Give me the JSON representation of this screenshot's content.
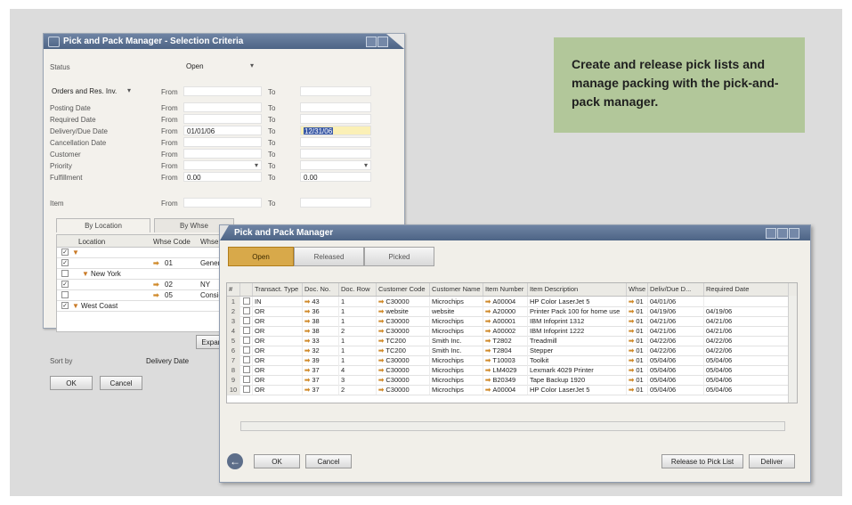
{
  "callout": {
    "text": "Create and release pick lists and manage packing with the pick-and-pack manager."
  },
  "selection_window": {
    "title": "Pick and Pack Manager - Selection Criteria",
    "status_label": "Status",
    "status_value": "Open",
    "doc_type": "Orders and Res. Inv.",
    "from_label": "From",
    "to_label": "To",
    "rows": [
      {
        "label": "Posting Date",
        "from": "",
        "to": ""
      },
      {
        "label": "Required Date",
        "from": "",
        "to": ""
      },
      {
        "label": "Delivery/Due Date",
        "from": "01/01/06",
        "to": "12/31/06"
      },
      {
        "label": "Cancellation Date",
        "from": "",
        "to": ""
      },
      {
        "label": "Customer",
        "from": "",
        "to": ""
      },
      {
        "label": "Priority",
        "from": "",
        "to": ""
      },
      {
        "label": "Fulfillment",
        "from": "0.00",
        "to": "0.00"
      }
    ],
    "item_label": "Item",
    "tabs": [
      "By Location",
      "By Whse"
    ],
    "grid_headers": [
      "Location",
      "Whse Code",
      "Whse"
    ],
    "grid_rows": [
      {
        "checked": true,
        "location": "",
        "code": "",
        "name": ""
      },
      {
        "checked": true,
        "location": "",
        "code": "01",
        "name": "General"
      },
      {
        "checked": false,
        "location": "New York",
        "code": "",
        "name": ""
      },
      {
        "checked": true,
        "location": "",
        "code": "02",
        "name": "NY"
      },
      {
        "checked": false,
        "location": "",
        "code": "05",
        "name": "Consignment"
      },
      {
        "checked": true,
        "location": "West Coast",
        "code": "",
        "name": ""
      }
    ],
    "expand_button": "Expand",
    "sort_label": "Sort by",
    "sort_value": "Delivery Date",
    "ok": "OK",
    "cancel": "Cancel"
  },
  "manager_window": {
    "title": "Pick and Pack Manager",
    "tabs": [
      "Open",
      "Released",
      "Picked"
    ],
    "active_tab": "Open",
    "columns": [
      "#",
      "",
      "Transact. Type",
      "Doc. No.",
      "Doc. Row",
      "Customer Code",
      "Customer Name",
      "Item Number",
      "Item Description",
      "Whse",
      "Deliv/Due D...",
      "Required Date"
    ],
    "rows": [
      {
        "n": "1",
        "type": "IN",
        "doc": "43",
        "row": "1",
        "cust": "C30000",
        "name": "Microchips",
        "item": "A00004",
        "desc": "HP Color LaserJet 5",
        "whse": "01",
        "due": "04/01/06",
        "req": ""
      },
      {
        "n": "2",
        "type": "OR",
        "doc": "36",
        "row": "1",
        "cust": "website",
        "name": "website",
        "item": "A20000",
        "desc": "Printer Pack 100 for home use",
        "whse": "01",
        "due": "04/19/06",
        "req": "04/19/06"
      },
      {
        "n": "3",
        "type": "OR",
        "doc": "38",
        "row": "1",
        "cust": "C30000",
        "name": "Microchips",
        "item": "A00001",
        "desc": "IBM Infoprint 1312",
        "whse": "01",
        "due": "04/21/06",
        "req": "04/21/06"
      },
      {
        "n": "4",
        "type": "OR",
        "doc": "38",
        "row": "2",
        "cust": "C30000",
        "name": "Microchips",
        "item": "A00002",
        "desc": "IBM Infoprint 1222",
        "whse": "01",
        "due": "04/21/06",
        "req": "04/21/06"
      },
      {
        "n": "5",
        "type": "OR",
        "doc": "33",
        "row": "1",
        "cust": "TC200",
        "name": "Smith Inc.",
        "item": "T2802",
        "desc": "Treadmill",
        "whse": "01",
        "due": "04/22/06",
        "req": "04/22/06"
      },
      {
        "n": "6",
        "type": "OR",
        "doc": "32",
        "row": "1",
        "cust": "TC200",
        "name": "Smith Inc.",
        "item": "T2804",
        "desc": "Stepper",
        "whse": "01",
        "due": "04/22/06",
        "req": "04/22/06"
      },
      {
        "n": "7",
        "type": "OR",
        "doc": "39",
        "row": "1",
        "cust": "C30000",
        "name": "Microchips",
        "item": "T10003",
        "desc": "Toolkit",
        "whse": "01",
        "due": "05/04/06",
        "req": "05/04/06"
      },
      {
        "n": "8",
        "type": "OR",
        "doc": "37",
        "row": "4",
        "cust": "C30000",
        "name": "Microchips",
        "item": "LM4029",
        "desc": "Lexmark 4029 Printer",
        "whse": "01",
        "due": "05/04/06",
        "req": "05/04/06"
      },
      {
        "n": "9",
        "type": "OR",
        "doc": "37",
        "row": "3",
        "cust": "C30000",
        "name": "Microchips",
        "item": "B20349",
        "desc": "Tape Backup 1920",
        "whse": "01",
        "due": "05/04/06",
        "req": "05/04/06"
      },
      {
        "n": "10",
        "type": "OR",
        "doc": "37",
        "row": "2",
        "cust": "C30000",
        "name": "Microchips",
        "item": "A00004",
        "desc": "HP Color LaserJet 5",
        "whse": "01",
        "due": "05/04/06",
        "req": "05/04/06"
      }
    ],
    "ok": "OK",
    "cancel": "Cancel",
    "release": "Release to Pick List",
    "deliver": "Deliver"
  }
}
